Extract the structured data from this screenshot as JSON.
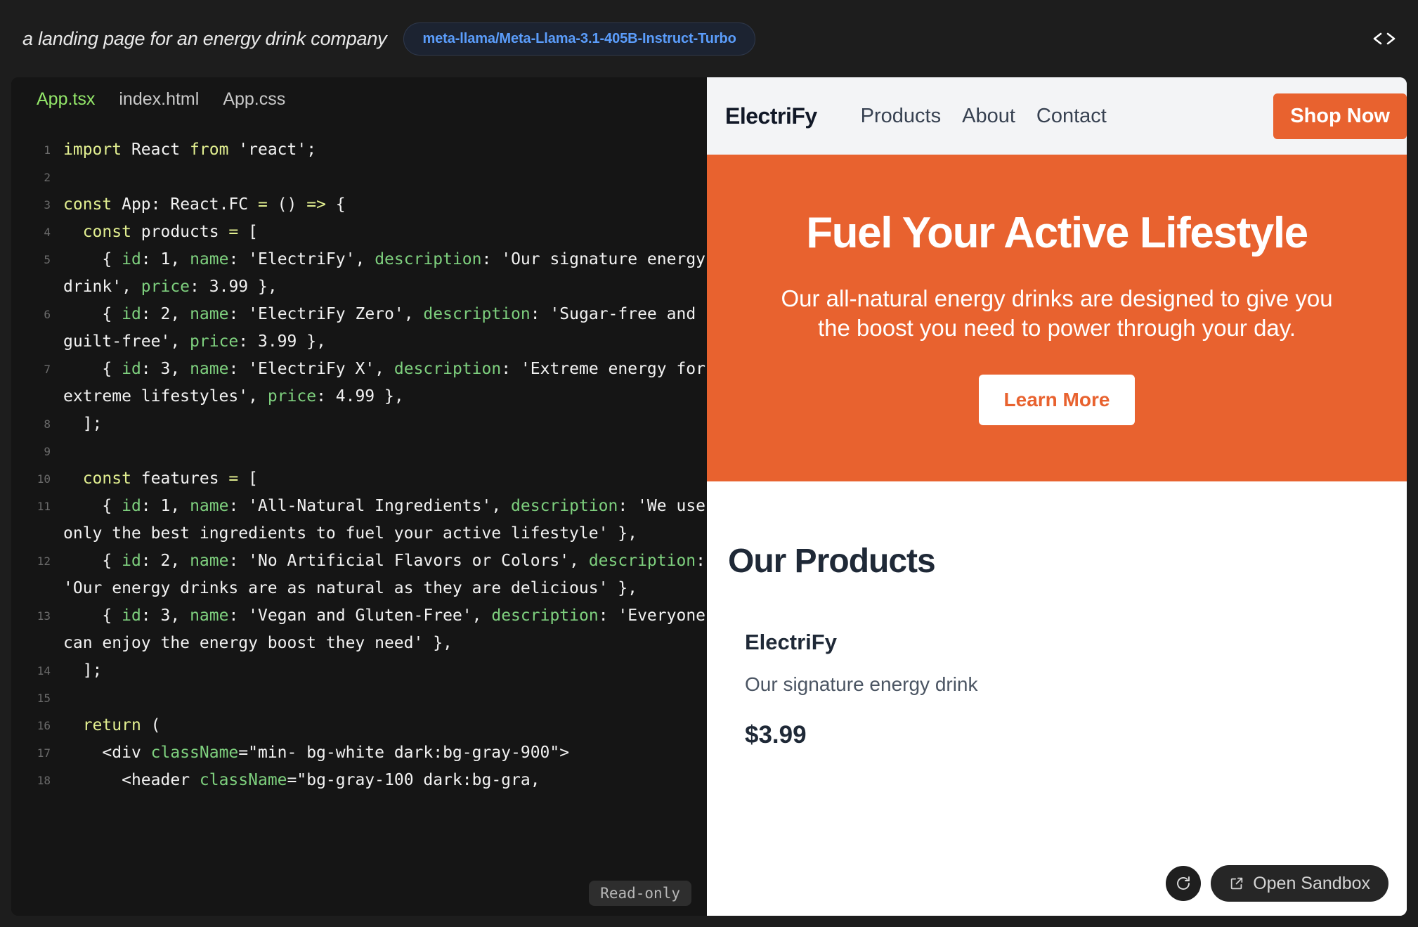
{
  "topbar": {
    "prompt": "a landing page for an energy drink company",
    "model": "meta-llama/Meta-Llama-3.1-405B-Instruct-Turbo",
    "code_toggle_icon": "code-brackets-icon"
  },
  "editor": {
    "tabs": [
      {
        "label": "App.tsx",
        "active": true
      },
      {
        "label": "index.html",
        "active": false
      },
      {
        "label": "App.css",
        "active": false
      }
    ],
    "readonly_label": "Read-only",
    "lines": [
      {
        "num": "1",
        "tokens": [
          [
            "k",
            "import "
          ],
          [
            "pl",
            "React "
          ],
          [
            "k",
            "from "
          ],
          [
            "s",
            "'react'"
          ],
          [
            "pl",
            ";"
          ]
        ]
      },
      {
        "num": "2",
        "tokens": [
          [
            "pl",
            ""
          ]
        ]
      },
      {
        "num": "3",
        "tokens": [
          [
            "k",
            "const "
          ],
          [
            "pl",
            "App"
          ],
          [
            "pl",
            ": "
          ],
          [
            "pl",
            "React.FC "
          ],
          [
            "k",
            "= "
          ],
          [
            "pl",
            "() "
          ],
          [
            "k",
            "=> "
          ],
          [
            "pl",
            "{"
          ]
        ]
      },
      {
        "num": "4",
        "tokens": [
          [
            "pl",
            "  "
          ],
          [
            "k",
            "const "
          ],
          [
            "pl",
            "products "
          ],
          [
            "k",
            "= "
          ],
          [
            "pl",
            "["
          ]
        ]
      },
      {
        "num": "5",
        "tokens": [
          [
            "pl",
            "    { "
          ],
          [
            "p",
            "id"
          ],
          [
            "pl",
            ": "
          ],
          [
            "n",
            "1"
          ],
          [
            "pl",
            ", "
          ],
          [
            "p",
            "name"
          ],
          [
            "pl",
            ": "
          ],
          [
            "s",
            "'ElectriFy'"
          ],
          [
            "pl",
            ", "
          ],
          [
            "p",
            "description"
          ],
          [
            "pl",
            ": "
          ],
          [
            "s",
            "'Our signature energy drink'"
          ],
          [
            "pl",
            ", "
          ],
          [
            "p",
            "price"
          ],
          [
            "pl",
            ": "
          ],
          [
            "n",
            "3.99"
          ],
          [
            "pl",
            " },"
          ]
        ]
      },
      {
        "num": "6",
        "tokens": [
          [
            "pl",
            "    { "
          ],
          [
            "p",
            "id"
          ],
          [
            "pl",
            ": "
          ],
          [
            "n",
            "2"
          ],
          [
            "pl",
            ", "
          ],
          [
            "p",
            "name"
          ],
          [
            "pl",
            ": "
          ],
          [
            "s",
            "'ElectriFy Zero'"
          ],
          [
            "pl",
            ", "
          ],
          [
            "p",
            "description"
          ],
          [
            "pl",
            ": "
          ],
          [
            "s",
            "'Sugar-free and guilt-free'"
          ],
          [
            "pl",
            ", "
          ],
          [
            "p",
            "price"
          ],
          [
            "pl",
            ": "
          ],
          [
            "n",
            "3.99"
          ],
          [
            "pl",
            " },"
          ]
        ]
      },
      {
        "num": "7",
        "tokens": [
          [
            "pl",
            "    { "
          ],
          [
            "p",
            "id"
          ],
          [
            "pl",
            ": "
          ],
          [
            "n",
            "3"
          ],
          [
            "pl",
            ", "
          ],
          [
            "p",
            "name"
          ],
          [
            "pl",
            ": "
          ],
          [
            "s",
            "'ElectriFy X'"
          ],
          [
            "pl",
            ", "
          ],
          [
            "p",
            "description"
          ],
          [
            "pl",
            ": "
          ],
          [
            "s",
            "'Extreme energy for extreme lifestyles'"
          ],
          [
            "pl",
            ", "
          ],
          [
            "p",
            "price"
          ],
          [
            "pl",
            ": "
          ],
          [
            "n",
            "4.99"
          ],
          [
            "pl",
            " },"
          ]
        ]
      },
      {
        "num": "8",
        "tokens": [
          [
            "pl",
            "  ];"
          ]
        ]
      },
      {
        "num": "9",
        "tokens": [
          [
            "pl",
            ""
          ]
        ]
      },
      {
        "num": "10",
        "tokens": [
          [
            "pl",
            "  "
          ],
          [
            "k",
            "const "
          ],
          [
            "pl",
            "features "
          ],
          [
            "k",
            "= "
          ],
          [
            "pl",
            "["
          ]
        ]
      },
      {
        "num": "11",
        "tokens": [
          [
            "pl",
            "    { "
          ],
          [
            "p",
            "id"
          ],
          [
            "pl",
            ": "
          ],
          [
            "n",
            "1"
          ],
          [
            "pl",
            ", "
          ],
          [
            "p",
            "name"
          ],
          [
            "pl",
            ": "
          ],
          [
            "s",
            "'All-Natural Ingredients'"
          ],
          [
            "pl",
            ", "
          ],
          [
            "p",
            "description"
          ],
          [
            "pl",
            ": "
          ],
          [
            "s",
            "'We use only the best ingredients to fuel your active lifestyle'"
          ],
          [
            "pl",
            " },"
          ]
        ]
      },
      {
        "num": "12",
        "tokens": [
          [
            "pl",
            "    { "
          ],
          [
            "p",
            "id"
          ],
          [
            "pl",
            ": "
          ],
          [
            "n",
            "2"
          ],
          [
            "pl",
            ", "
          ],
          [
            "p",
            "name"
          ],
          [
            "pl",
            ": "
          ],
          [
            "s",
            "'No Artificial Flavors or Colors'"
          ],
          [
            "pl",
            ", "
          ],
          [
            "p",
            "description"
          ],
          [
            "pl",
            ": "
          ],
          [
            "s",
            "'Our energy drinks are as natural as they are delicious'"
          ],
          [
            "pl",
            " },"
          ]
        ]
      },
      {
        "num": "13",
        "tokens": [
          [
            "pl",
            "    { "
          ],
          [
            "p",
            "id"
          ],
          [
            "pl",
            ": "
          ],
          [
            "n",
            "3"
          ],
          [
            "pl",
            ", "
          ],
          [
            "p",
            "name"
          ],
          [
            "pl",
            ": "
          ],
          [
            "s",
            "'Vegan and Gluten-Free'"
          ],
          [
            "pl",
            ", "
          ],
          [
            "p",
            "description"
          ],
          [
            "pl",
            ": "
          ],
          [
            "s",
            "'Everyone can enjoy the energy boost they need'"
          ],
          [
            "pl",
            " },"
          ]
        ]
      },
      {
        "num": "14",
        "tokens": [
          [
            "pl",
            "  ];"
          ]
        ]
      },
      {
        "num": "15",
        "tokens": [
          [
            "pl",
            ""
          ]
        ]
      },
      {
        "num": "16",
        "tokens": [
          [
            "pl",
            "  "
          ],
          [
            "k",
            "return "
          ],
          [
            "pl",
            "("
          ]
        ]
      },
      {
        "num": "17",
        "tokens": [
          [
            "pl",
            "    <"
          ],
          [
            "tg",
            "div "
          ],
          [
            "at",
            "className"
          ],
          [
            "pl",
            "="
          ],
          [
            "s",
            "\"min- bg-white dark:bg-gray-900\""
          ],
          [
            "pl",
            ">"
          ]
        ]
      },
      {
        "num": "18",
        "tokens": [
          [
            "pl",
            "      <"
          ],
          [
            "tg",
            "header "
          ],
          [
            "at",
            "className"
          ],
          [
            "pl",
            "="
          ],
          [
            "s",
            "\"bg-gray-100 dark:bg-gra,"
          ]
        ]
      }
    ]
  },
  "preview": {
    "header": {
      "brand": "ElectriFy",
      "nav": [
        "Products",
        "About",
        "Contact"
      ],
      "cta": "Shop Now"
    },
    "hero": {
      "heading": "Fuel Your Active Lifestyle",
      "subheading": "Our all-natural energy drinks are designed to give you the boost you need to power through your day.",
      "cta": "Learn More"
    },
    "products": {
      "title": "Our Products",
      "items": [
        {
          "name": "ElectriFy",
          "description": "Our signature energy drink",
          "price": "$3.99"
        }
      ]
    },
    "actions": {
      "refresh_icon": "refresh-icon",
      "sandbox_icon": "external-link-icon",
      "sandbox_label": "Open Sandbox"
    }
  },
  "colors": {
    "accent_orange": "#e8622f",
    "badge_blue": "#5b9dfb",
    "tab_active_green": "#94e86a",
    "app_bg": "#1d1d1d",
    "editor_bg": "#151515"
  }
}
